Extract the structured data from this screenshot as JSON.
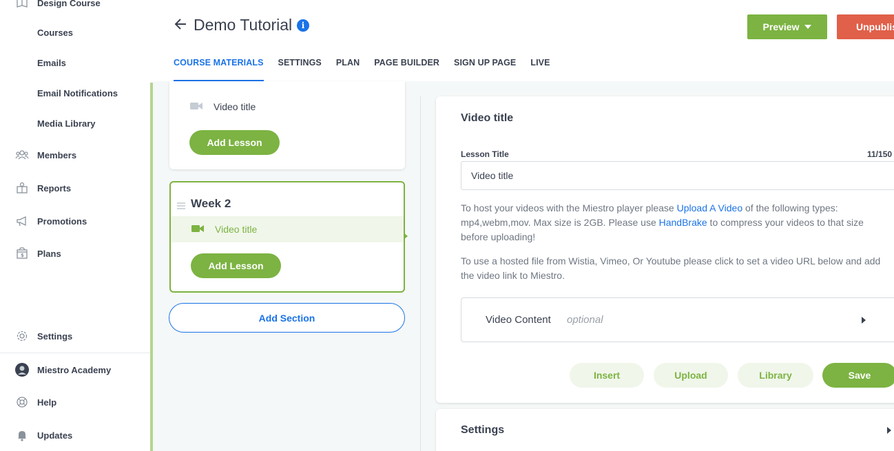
{
  "sidebar": {
    "top_cut_item": "Design Course",
    "sub_items": [
      "Courses",
      "Emails",
      "Email Notifications",
      "Media Library"
    ],
    "items": [
      {
        "label": "Members",
        "icon": "members-icon"
      },
      {
        "label": "Reports",
        "icon": "reports-icon"
      },
      {
        "label": "Promotions",
        "icon": "megaphone-icon"
      },
      {
        "label": "Plans",
        "icon": "plans-icon"
      }
    ],
    "settings_label": "Settings",
    "account_label": "Miestro Academy",
    "help_label": "Help",
    "updates_label": "Updates"
  },
  "header": {
    "title": "Demo Tutorial",
    "info_glyph": "i",
    "preview_label": "Preview",
    "unpublish_label": "Unpublish",
    "tabs": [
      {
        "label": "COURSE MATERIALS",
        "active": true
      },
      {
        "label": "SETTINGS",
        "active": false
      },
      {
        "label": "PLAN",
        "active": false
      },
      {
        "label": "PAGE BUILDER",
        "active": false
      },
      {
        "label": "SIGN UP PAGE",
        "active": false
      },
      {
        "label": "LIVE",
        "active": false
      }
    ]
  },
  "curriculum": {
    "section1": {
      "lesson_title": "Video title",
      "add_lesson_label": "Add Lesson"
    },
    "section2": {
      "title": "Week 2",
      "lesson_title": "Video title",
      "add_lesson_label": "Add Lesson"
    },
    "add_section_label": "Add Section"
  },
  "editor": {
    "title": "Video title",
    "field_label": "Lesson Title",
    "char_count": "11/150",
    "lesson_title_value": "Video title",
    "help1": {
      "part1": "To host your videos with the Miestro player please ",
      "link1": "Upload A Video",
      "part2": " of the following types: mp4,webm,mov. Max size is 2GB. Please use ",
      "link2": "HandBrake",
      "part3": " to compress your videos to that size before uploading!"
    },
    "help2": "To use a hosted file from Wistia, Vimeo, Or Youtube please click to set a video URL below and add the video link to Miestro.",
    "video_content_label": "Video Content",
    "video_content_optional": "optional",
    "buttons": {
      "insert": "Insert",
      "upload": "Upload",
      "library": "Library",
      "save": "Save"
    }
  },
  "settings_panel": {
    "title": "Settings"
  },
  "colors": {
    "accent_green": "#7cb342",
    "link_blue": "#1a73e8",
    "unpublish_red": "#e0604a"
  }
}
